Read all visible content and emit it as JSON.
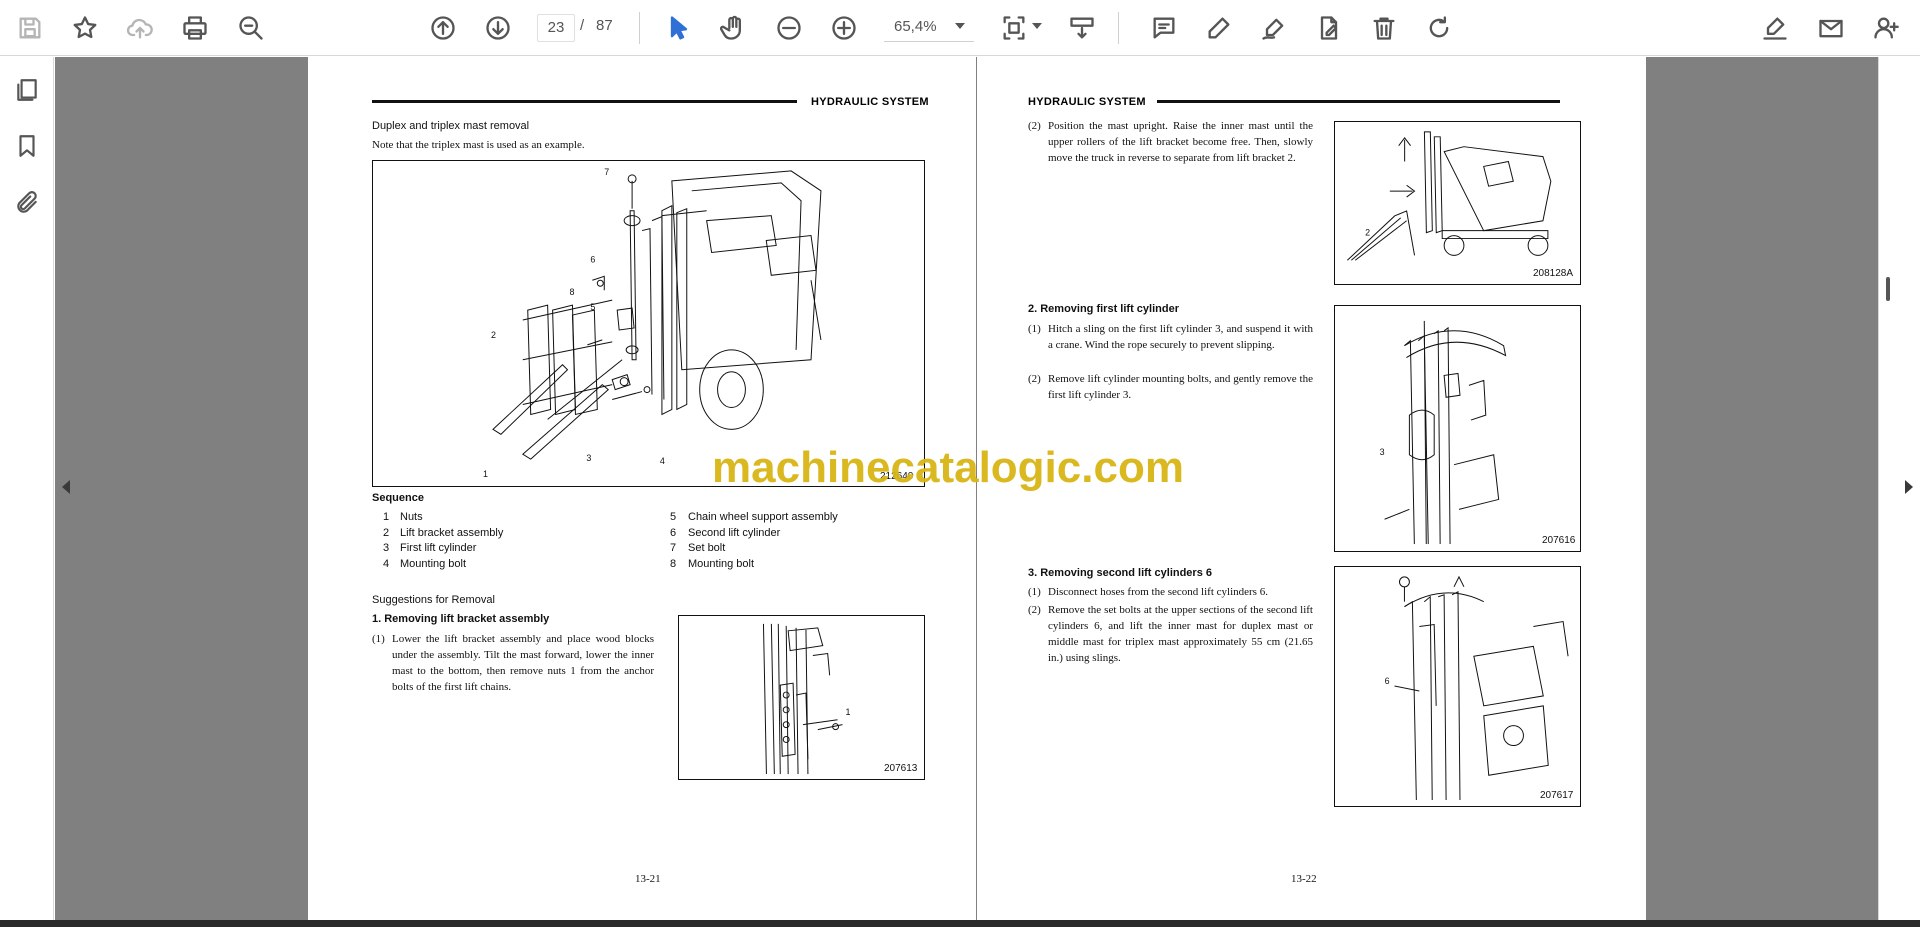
{
  "toolbar": {
    "current_page": "23",
    "page_separator": "/",
    "total_pages": "87",
    "zoom": "65,4%"
  },
  "left_page": {
    "header": "HYDRAULIC SYSTEM",
    "title": "Duplex and triplex mast removal",
    "note": "Note that the triplex mast is used as an example.",
    "fig_main_id": "212640",
    "callouts_main": [
      "7",
      "6",
      "8",
      "5",
      "2",
      "3",
      "1",
      "4"
    ],
    "sequence_label": "Sequence",
    "sequence": [
      {
        "n": "1",
        "label": "Nuts"
      },
      {
        "n": "2",
        "label": "Lift bracket assembly"
      },
      {
        "n": "3",
        "label": "First lift cylinder"
      },
      {
        "n": "4",
        "label": "Mounting bolt"
      },
      {
        "n": "5",
        "label": "Chain wheel support assembly"
      },
      {
        "n": "6",
        "label": "Second lift cylinder"
      },
      {
        "n": "7",
        "label": "Set bolt"
      },
      {
        "n": "8",
        "label": "Mounting bolt"
      }
    ],
    "suggestions_title": "Suggestions for Removal",
    "step1_title": "1.  Removing lift bracket assembly",
    "step1_items": [
      {
        "n": "(1)",
        "text": "Lower the lift bracket assembly and place wood blocks under the assembly.  Tilt the mast forward, lower the inner mast to the bottom, then remove nuts 1 from the anchor bolts of the first lift chains."
      }
    ],
    "fig_step1_id": "207613",
    "fig_step1_callout": "1",
    "page_number": "13-21"
  },
  "right_page": {
    "header": "HYDRAULIC SYSTEM",
    "intro_items": [
      {
        "n": "(2)",
        "text": "Position the mast upright.  Raise the inner mast until the upper rollers of the lift bracket become free.  Then, slowly move the truck in reverse to separate from lift bracket 2."
      }
    ],
    "fig1_id": "208128A",
    "fig1_callout": "2",
    "step2_title": "2.  Removing first lift cylinder",
    "step2_items": [
      {
        "n": "(1)",
        "text": "Hitch a sling on the first lift cylinder 3, and suspend it with a crane.  Wind the rope securely to prevent slipping."
      },
      {
        "n": "(2)",
        "text": "Remove lift cylinder mounting bolts, and gently remove the first lift cylinder 3."
      }
    ],
    "fig2_id": "207616",
    "fig2_callout": "3",
    "step3_title": "3.  Removing second lift cylinders 6",
    "step3_items": [
      {
        "n": "(1)",
        "text": "Disconnect hoses from the second lift cylinders 6."
      },
      {
        "n": "(2)",
        "text": "Remove the set bolts at the upper sections of the second lift cylinders 6, and lift the inner mast for duplex mast or middle mast for triplex mast approximately 55 cm (21.65 in.) using slings."
      }
    ],
    "fig3_id": "207617",
    "fig3_callout": "6",
    "page_number": "13-22"
  },
  "watermark": "machinecatalogic.com",
  "colors": {
    "viewer_bg": "#808080",
    "accent_blue": "#2f6fd6",
    "watermark": "#d9b515"
  }
}
